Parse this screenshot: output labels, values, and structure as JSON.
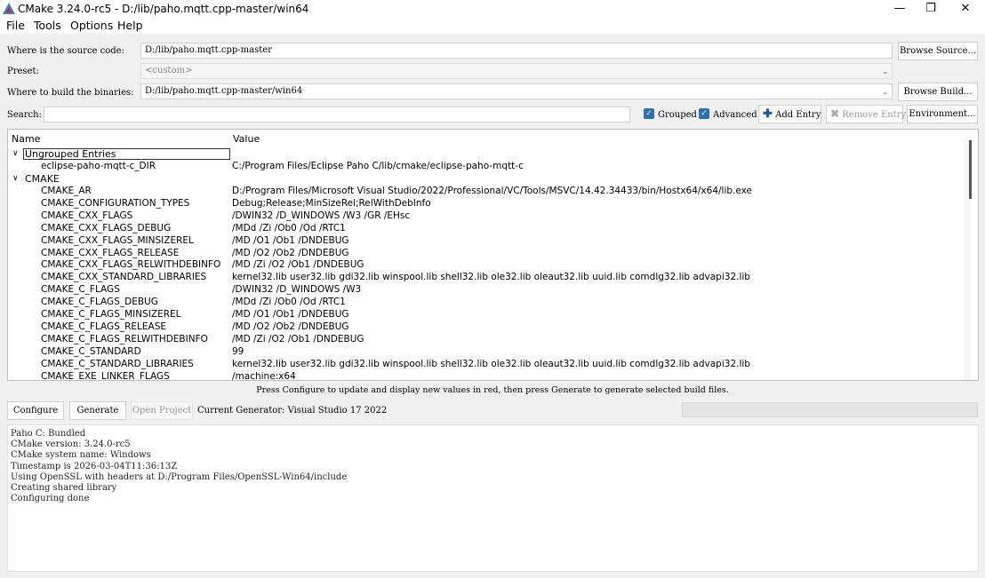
{
  "window": {
    "title": "CMake 3.24.0-rc5 - D:/lib/paho.mqtt.cpp-master/win64"
  },
  "menu": [
    "File",
    "Tools",
    "Options",
    "Help"
  ],
  "source": {
    "label": "Where is the source code:",
    "value": "D:/lib/paho.mqtt.cpp-master",
    "browse": "Browse Source..."
  },
  "preset": {
    "label": "Preset:",
    "value": "<custom>"
  },
  "build": {
    "label": "Where to build the binaries:",
    "value": "D:/lib/paho.mqtt.cpp-master/win64",
    "browse": "Browse Build..."
  },
  "search": {
    "label": "Search:",
    "value": ""
  },
  "toolbar": {
    "grouped": "Grouped",
    "advanced": "Advanced",
    "add_entry": "Add Entry",
    "remove_entry": "Remove Entry",
    "environment": "Environment..."
  },
  "table": {
    "headers": {
      "name": "Name",
      "value": "Value"
    },
    "group1": "Ungrouped Entries",
    "group1_rows": [
      {
        "name": "eclipse-paho-mqtt-c_DIR",
        "value": "C:/Program Files/Eclipse Paho C/lib/cmake/eclipse-paho-mqtt-c"
      }
    ],
    "group2": "CMAKE",
    "group2_rows": [
      {
        "name": "CMAKE_AR",
        "value": "D:/Program Files/Microsoft Visual Studio/2022/Professional/VC/Tools/MSVC/14.42.34433/bin/Hostx64/x64/lib.exe"
      },
      {
        "name": "CMAKE_CONFIGURATION_TYPES",
        "value": "Debug;Release;MinSizeRel;RelWithDebInfo"
      },
      {
        "name": "CMAKE_CXX_FLAGS",
        "value": "/DWIN32 /D_WINDOWS /W3 /GR /EHsc"
      },
      {
        "name": "CMAKE_CXX_FLAGS_DEBUG",
        "value": "/MDd /Zi /Ob0 /Od /RTC1"
      },
      {
        "name": "CMAKE_CXX_FLAGS_MINSIZEREL",
        "value": "/MD /O1 /Ob1 /DNDEBUG"
      },
      {
        "name": "CMAKE_CXX_FLAGS_RELEASE",
        "value": "/MD /O2 /Ob2 /DNDEBUG"
      },
      {
        "name": "CMAKE_CXX_FLAGS_RELWITHDEBINFO",
        "value": "/MD /Zi /O2 /Ob1 /DNDEBUG"
      },
      {
        "name": "CMAKE_CXX_STANDARD_LIBRARIES",
        "value": "kernel32.lib user32.lib gdi32.lib winspool.lib shell32.lib ole32.lib oleaut32.lib uuid.lib comdlg32.lib advapi32.lib"
      },
      {
        "name": "CMAKE_C_FLAGS",
        "value": "/DWIN32 /D_WINDOWS /W3"
      },
      {
        "name": "CMAKE_C_FLAGS_DEBUG",
        "value": "/MDd /Zi /Ob0 /Od /RTC1"
      },
      {
        "name": "CMAKE_C_FLAGS_MINSIZEREL",
        "value": "/MD /O1 /Ob1 /DNDEBUG"
      },
      {
        "name": "CMAKE_C_FLAGS_RELEASE",
        "value": "/MD /O2 /Ob2 /DNDEBUG"
      },
      {
        "name": "CMAKE_C_FLAGS_RELWITHDEBINFO",
        "value": "/MD /Zi /O2 /Ob1 /DNDEBUG"
      },
      {
        "name": "CMAKE_C_STANDARD",
        "value": "99"
      },
      {
        "name": "CMAKE_C_STANDARD_LIBRARIES",
        "value": "kernel32.lib user32.lib gdi32.lib winspool.lib shell32.lib ole32.lib oleaut32.lib uuid.lib comdlg32.lib advapi32.lib"
      },
      {
        "name": "CMAKE_EXE_LINKER_FLAGS",
        "value": "/machine:x64"
      }
    ]
  },
  "hint": "Press Configure to update and display new values in red, then press Generate to generate selected build files.",
  "actions": {
    "configure": "Configure",
    "generate": "Generate",
    "open_project": "Open Project",
    "generator": "Current Generator: Visual Studio 17 2022"
  },
  "output": [
    "Paho C: Bundled",
    "CMake version: 3.24.0-rc5",
    "CMake system name: Windows",
    "Timestamp is 2026-03-04T11:36:13Z",
    "Using OpenSSL with headers at D:/Program Files/OpenSSL-Win64/include",
    "Creating shared library",
    "Configuring done"
  ],
  "colors": {
    "accent": "#2f6fb5",
    "add_icon": "#1e5aa8"
  }
}
